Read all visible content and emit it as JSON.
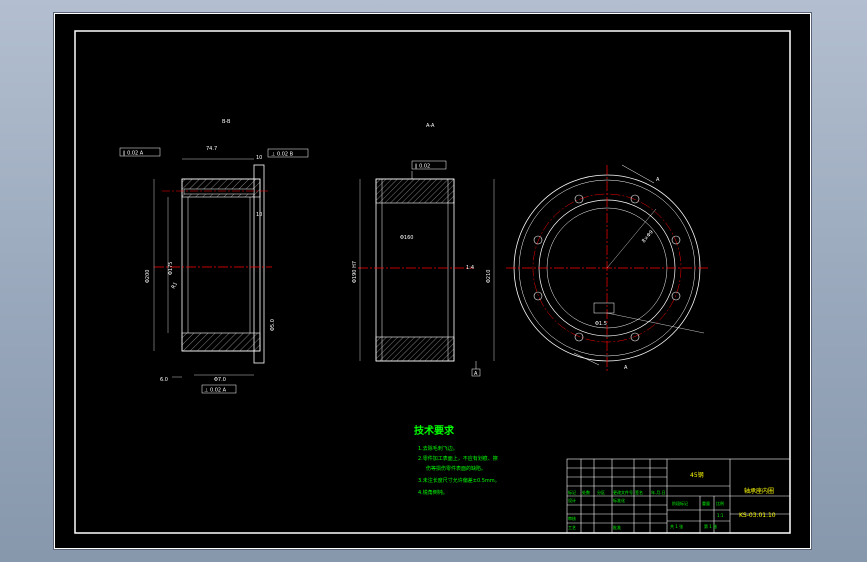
{
  "colors": {
    "background": "#000000",
    "frame": "#ffffff",
    "centerline": "#ff0000",
    "hatch": "#ffffff",
    "text_green": "#00ff00",
    "text_yellow": "#ffff00"
  },
  "views": {
    "left_label": "B-B",
    "middle_label": "A-A"
  },
  "left_view": {
    "tol_box_top_left": "∥ 0.02 A",
    "dim_top": "74.7",
    "dim_top_right": "10",
    "tol_box_top_right": "⊥ 0.02 B",
    "dim_right_10": "10",
    "dim_left_diam": "Φ200",
    "dim_inner_diam": "Φ175",
    "dim_r": "R1",
    "dim_right_bottom": "Φ5.0",
    "dim_bottom_left": "6.0",
    "dim_bottom_mid": "Φ7.0",
    "tol_box_bottom": "⊥ 0.02 A"
  },
  "middle_view": {
    "tol_box": "∥ 0.02",
    "dim_left": "Φ190 H7",
    "dim_inner": "Φ160",
    "dim_right_label": "1:4",
    "dim_right": "Φ210",
    "datum": "A"
  },
  "right_view": {
    "label_a_top": "A",
    "label_a_bottom": "A",
    "dim_callout": "8×Φ9",
    "dim_small": "Φ1.5"
  },
  "tech_req": {
    "title": "技术要求",
    "lines": [
      "1.去除毛刺飞边。",
      "2.零件加工表面上，不应有划痕、擦",
      "伤等损伤零件表面的缺陷。",
      "3.未注长度尺寸允许偏差±0.5mm。",
      "4.锐角倒钝。"
    ]
  },
  "title_block": {
    "material": "45钢",
    "part_name": "轴承座内圈",
    "drawing_no": "KS-03.01.10",
    "row_labels": [
      "标记",
      "处数",
      "分区",
      "更改文件号",
      "签名",
      "年.月.日"
    ],
    "col_labels": [
      "阶段标记",
      "重量",
      "比例"
    ],
    "scale": "1:1",
    "weight": "",
    "sheet_total": "共 1 张",
    "sheet_no": "第 1 张",
    "design": "设计",
    "check": "审核",
    "process": "工艺",
    "standard": "标准化",
    "approve": "批准"
  }
}
